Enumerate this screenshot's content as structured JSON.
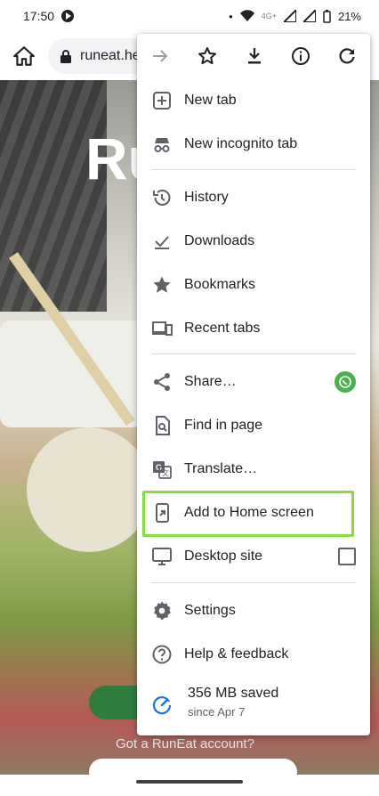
{
  "status_bar": {
    "time": "17:50",
    "battery": "21%",
    "lte": "4G+"
  },
  "toolbar": {
    "url": "runeat.he"
  },
  "page": {
    "brand": "Ru",
    "account_text": "Got a RunEat account?"
  },
  "menu": {
    "top_icons": [
      "forward-icon",
      "star-icon",
      "download-icon",
      "info-icon",
      "refresh-icon"
    ],
    "items": [
      {
        "label": "New tab",
        "icon": "new-tab-icon"
      },
      {
        "label": "New incognito tab",
        "icon": "incognito-icon"
      },
      {
        "label": "History",
        "icon": "history-icon"
      },
      {
        "label": "Downloads",
        "icon": "downloads-icon"
      },
      {
        "label": "Bookmarks",
        "icon": "bookmark-star-icon"
      },
      {
        "label": "Recent tabs",
        "icon": "recent-tabs-icon"
      },
      {
        "label": "Share…",
        "icon": "share-icon"
      },
      {
        "label": "Find in page",
        "icon": "find-in-page-icon"
      },
      {
        "label": "Translate…",
        "icon": "translate-icon"
      },
      {
        "label": "Add to Home screen",
        "icon": "add-to-home-icon"
      },
      {
        "label": "Desktop site",
        "icon": "desktop-icon"
      },
      {
        "label": "Settings",
        "icon": "settings-gear-icon"
      },
      {
        "label": "Help & feedback",
        "icon": "help-icon"
      }
    ],
    "saved": {
      "title": "356 MB saved",
      "subtitle": "since Apr 7"
    },
    "highlight_color": "#86dc3d"
  }
}
